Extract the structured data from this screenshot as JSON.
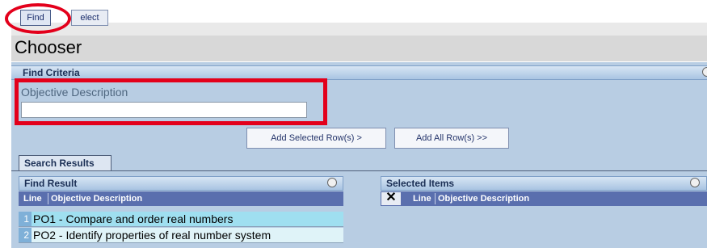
{
  "toolbar": {
    "find_label": "Find",
    "select_label": "elect"
  },
  "page": {
    "title": "Chooser"
  },
  "find_criteria": {
    "header": "Find Criteria",
    "field_label": "Objective Description",
    "field_value": ""
  },
  "actions": {
    "add_selected": "Add Selected Row(s) >",
    "add_all": "Add All Row(s) >>"
  },
  "tabs": {
    "search_results": "Search Results"
  },
  "find_result": {
    "header": "Find Result",
    "columns": {
      "line": "Line",
      "description": "Objective Description"
    },
    "rows": [
      {
        "line": "1",
        "description": "PO1 - Compare and order real numbers"
      },
      {
        "line": "2",
        "description": "PO2 - Identify properties of real number system"
      }
    ]
  },
  "selected_items": {
    "header": "Selected Items",
    "remove_glyph": "✕",
    "columns": {
      "line": "Line",
      "description": "Objective Description"
    }
  },
  "colors": {
    "annotation_red": "#e3001b",
    "panel_blue": "#b8cde3",
    "grid_header": "#5a6fae",
    "row_selected": "#9fdff0",
    "row_normal": "#dff3f8"
  }
}
